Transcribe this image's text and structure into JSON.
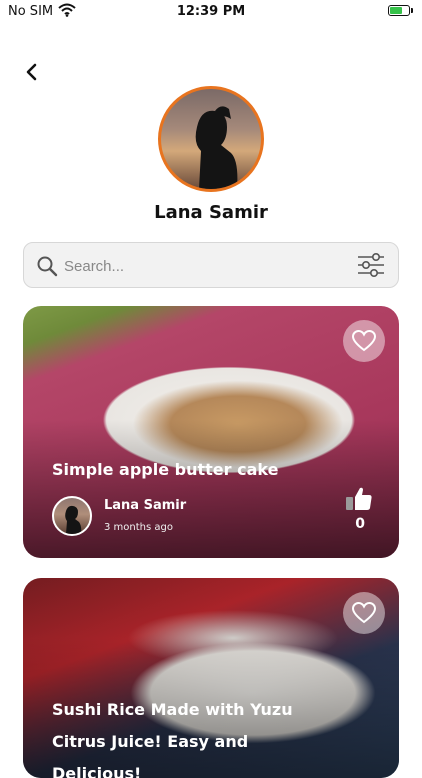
{
  "status_bar": {
    "carrier": "No SIM",
    "time": "12:39 PM",
    "battery_charging": true
  },
  "header": {
    "back_icon": "chevron-left-icon"
  },
  "profile": {
    "name": "Lana Samir",
    "accent_color": "#e8741f"
  },
  "search": {
    "placeholder": "Search...",
    "value": "",
    "filter_icon": "sliders-icon"
  },
  "recipes": [
    {
      "title": "Simple apple butter cake",
      "author": "Lana Samir",
      "time_ago": "3 months ago",
      "likes": "0",
      "favorite_icon": "heart-outline-icon",
      "like_icon": "thumbs-up-icon"
    },
    {
      "title": "Sushi Rice Made with Yuzu Citrus Juice! Easy and Delicious!",
      "favorite_icon": "heart-outline-icon"
    }
  ]
}
